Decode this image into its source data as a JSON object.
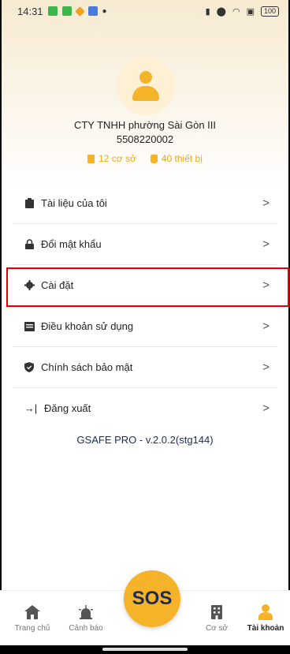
{
  "statusbar": {
    "time": "14:31",
    "battery": "100"
  },
  "profile": {
    "company": "CTY TNHH phường Sài Gòn III",
    "id": "5508220002",
    "facilities": "12 cơ sở",
    "devices": "40 thiết bị"
  },
  "menu": [
    {
      "label": "Tài liệu của tôi",
      "icon": "clipboard-icon"
    },
    {
      "label": "Đổi mật khẩu",
      "icon": "lock-icon"
    },
    {
      "label": "Cài đặt",
      "icon": "gear-icon"
    },
    {
      "label": "Điều khoản sử dụng",
      "icon": "book-icon"
    },
    {
      "label": "Chính sách bảo mật",
      "icon": "shield-icon"
    },
    {
      "label": "Đăng xuất",
      "icon": "logout-icon"
    }
  ],
  "chevron": ">",
  "version": "GSAFE PRO - v.2.0.2(stg144)",
  "nav": {
    "home": "Trang chủ",
    "alert": "Cảnh báo",
    "sos": "SOS",
    "facility": "Cơ sở",
    "account": "Tài khoản"
  },
  "colors": {
    "accent": "#f4b328",
    "highlight": "#e00000",
    "version_text": "#1d2b5b"
  }
}
